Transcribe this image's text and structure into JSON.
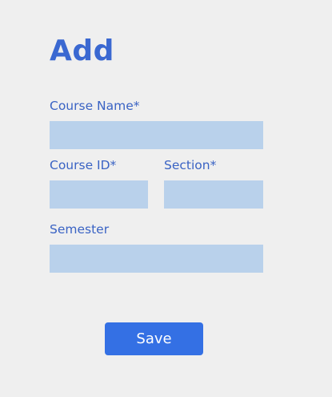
{
  "form": {
    "title": "Add",
    "course_name": {
      "label": "Course Name*",
      "value": "",
      "placeholder": ""
    },
    "course_id": {
      "label": "Course ID*",
      "value": "",
      "placeholder": ""
    },
    "section": {
      "label": "Section*",
      "value": "",
      "placeholder": ""
    },
    "semester": {
      "label": "Semester",
      "value": "",
      "placeholder": ""
    },
    "save_label": "Save"
  },
  "colors": {
    "background": "#efefef",
    "accent": "#3a68d1",
    "field_fill": "#b9d1eb",
    "button": "#3470e4"
  }
}
